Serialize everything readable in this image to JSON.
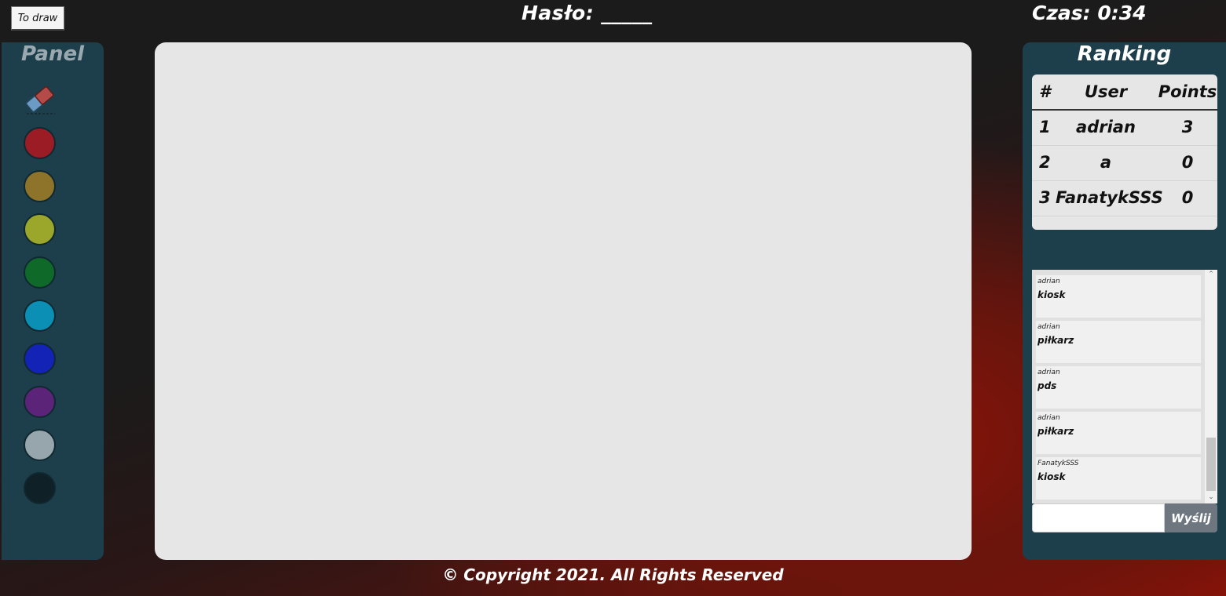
{
  "header": {
    "to_draw_button": "To draw",
    "word_hint": "Hasło: _____",
    "timer": "Czas: 0:34"
  },
  "panel": {
    "title": "Panel",
    "eraser_icon": "eraser-icon",
    "colors": [
      {
        "name": "red",
        "hex": "#9b1c24"
      },
      {
        "name": "ochre",
        "hex": "#8e742a"
      },
      {
        "name": "olive",
        "hex": "#9aa72b"
      },
      {
        "name": "green",
        "hex": "#0f6a2a"
      },
      {
        "name": "cyan",
        "hex": "#0c8fb4"
      },
      {
        "name": "blue",
        "hex": "#1223b6"
      },
      {
        "name": "purple",
        "hex": "#5b2478"
      },
      {
        "name": "gray",
        "hex": "#97a6ac"
      },
      {
        "name": "black",
        "hex": "#0f2126"
      }
    ]
  },
  "ranking": {
    "title": "Ranking",
    "columns": [
      "#",
      "User",
      "Points"
    ],
    "rows": [
      {
        "rank": "1",
        "user": "adrian",
        "points": "3"
      },
      {
        "rank": "2",
        "user": "a",
        "points": "0"
      },
      {
        "rank": "3",
        "user": "FanatykSSS",
        "points": "0"
      }
    ]
  },
  "chat": {
    "messages": [
      {
        "user": "adrian",
        "text": "kiosk"
      },
      {
        "user": "adrian",
        "text": "piłkarz"
      },
      {
        "user": "adrian",
        "text": "pds"
      },
      {
        "user": "adrian",
        "text": "piłkarz"
      },
      {
        "user": "FanatykSSS",
        "text": "kiosk"
      }
    ],
    "input_value": "",
    "send_label": "Wyślij"
  },
  "footer": {
    "text": "© Copyright 2021. All Rights Reserved"
  }
}
